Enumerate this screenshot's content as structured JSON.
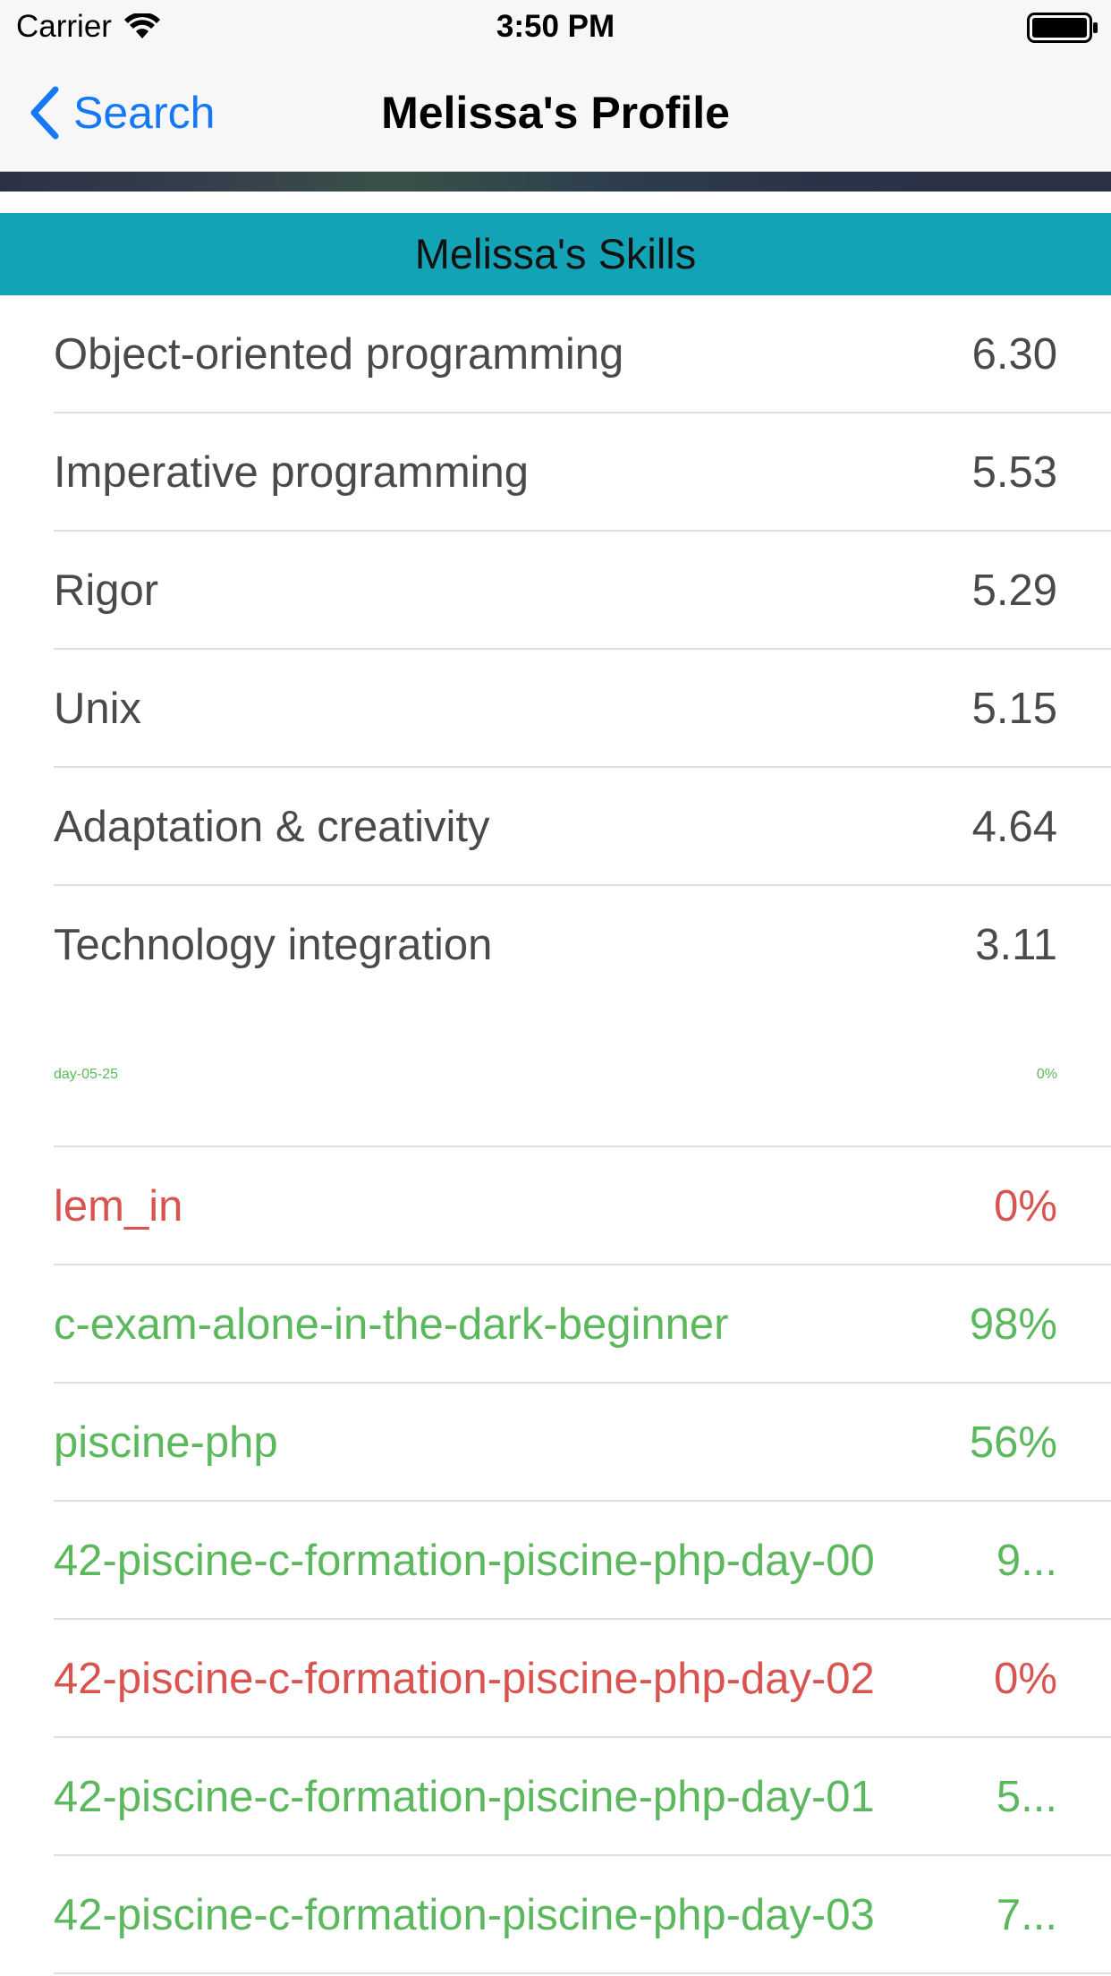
{
  "status_bar": {
    "carrier": "Carrier",
    "time": "3:50 PM",
    "icons": [
      "wifi-icon",
      "battery-icon"
    ]
  },
  "nav": {
    "back_label": "Search",
    "title": "Melissa's Profile",
    "icons": [
      "chevron-left-icon"
    ],
    "accent_color": "#1478f7"
  },
  "skills": {
    "header": "Melissa's Skills",
    "header_color": "#13a3b6",
    "items": [
      {
        "name": "Object-oriented programming",
        "level": "6.30"
      },
      {
        "name": "Imperative programming",
        "level": "5.53"
      },
      {
        "name": "Rigor",
        "level": "5.29"
      },
      {
        "name": "Unix",
        "level": "5.15"
      },
      {
        "name": "Adaptation & creativity",
        "level": "4.64"
      },
      {
        "name": "Technology integration",
        "level": "3.11"
      }
    ]
  },
  "projects": {
    "colors": {
      "success": "#5cb85c",
      "fail": "#d9534f"
    },
    "partial": {
      "name": "day-05-25",
      "mark": "0%",
      "status": "success"
    },
    "items": [
      {
        "name": "lem_in",
        "mark": "0%",
        "status": "fail"
      },
      {
        "name": "c-exam-alone-in-the-dark-beginner",
        "mark": "98%",
        "status": "success"
      },
      {
        "name": "piscine-php",
        "mark": "56%",
        "status": "success"
      },
      {
        "name": "42-piscine-c-formation-piscine-php-day-00",
        "mark": "9...",
        "status": "success"
      },
      {
        "name": "42-piscine-c-formation-piscine-php-day-02",
        "mark": "0%",
        "status": "fail"
      },
      {
        "name": "42-piscine-c-formation-piscine-php-day-01",
        "mark": "5...",
        "status": "success"
      },
      {
        "name": "42-piscine-c-formation-piscine-php-day-03",
        "mark": "7...",
        "status": "success"
      }
    ]
  }
}
